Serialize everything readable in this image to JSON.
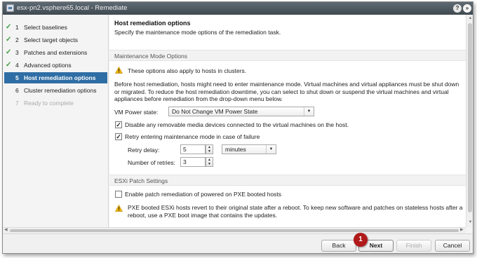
{
  "window": {
    "title": "esx-pn2.vsphere65.local - Remediate",
    "help_icon": "help-icon",
    "collapse_icon": "double-chevron-icon"
  },
  "nav": {
    "items": [
      {
        "num": "1",
        "label": "Select baselines",
        "state": "done"
      },
      {
        "num": "2",
        "label": "Select target objects",
        "state": "done"
      },
      {
        "num": "3",
        "label": "Patches and extensions",
        "state": "done"
      },
      {
        "num": "4",
        "label": "Advanced options",
        "state": "done"
      },
      {
        "num": "5",
        "label": "Host remediation options",
        "state": "active"
      },
      {
        "num": "6",
        "label": "Cluster remediation options",
        "state": "pending"
      },
      {
        "num": "7",
        "label": "Ready to complete",
        "state": "disabled"
      }
    ],
    "check_glyph": "✓",
    "active_color": "#2f6ea5"
  },
  "page": {
    "title": "Host remediation options",
    "subtitle": "Specify the maintenance mode options of the remediation task."
  },
  "maintenance": {
    "header": "Maintenance Mode Options",
    "warning": "These options also apply to hosts in clusters.",
    "description": "Before host remediation, hosts might need to enter maintenance mode. Virtual machines and virtual appliances must be shut down or migrated. To reduce the host remediation downtime, you can select to shut down or suspend the virtual machines and virtual appliances before remediation from the drop-down menu below.",
    "vm_power_label": "VM Power state:",
    "vm_power_value": "Do Not Change VM Power State",
    "disable_media_label": "Disable any removable media devices connected to the virtual machines on the host.",
    "disable_media_checked": true,
    "retry_label": "Retry entering maintenance mode in case of failure",
    "retry_checked": true,
    "retry_delay_label": "Retry delay:",
    "retry_delay_value": "5",
    "retry_delay_unit": "minutes",
    "retries_label": "Number of retries:",
    "retries_value": "3"
  },
  "esxi": {
    "header": "ESXi Patch Settings",
    "pxe_label": "Enable patch remediation of powered on PXE booted hosts",
    "pxe_checked": false,
    "pxe_warning": "PXE booted ESXi hosts revert to their original state after a reboot. To keep new software and patches on stateless hosts after a reboot, use a PXE boot image that contains the updates."
  },
  "footer": {
    "back": "Back",
    "next": "Next",
    "finish": "Finish",
    "cancel": "Cancel"
  },
  "callout": {
    "number": "1",
    "color": "#b11a1a"
  },
  "colors": {
    "warning": "#f0b400",
    "title_bar": "#4a545c"
  }
}
